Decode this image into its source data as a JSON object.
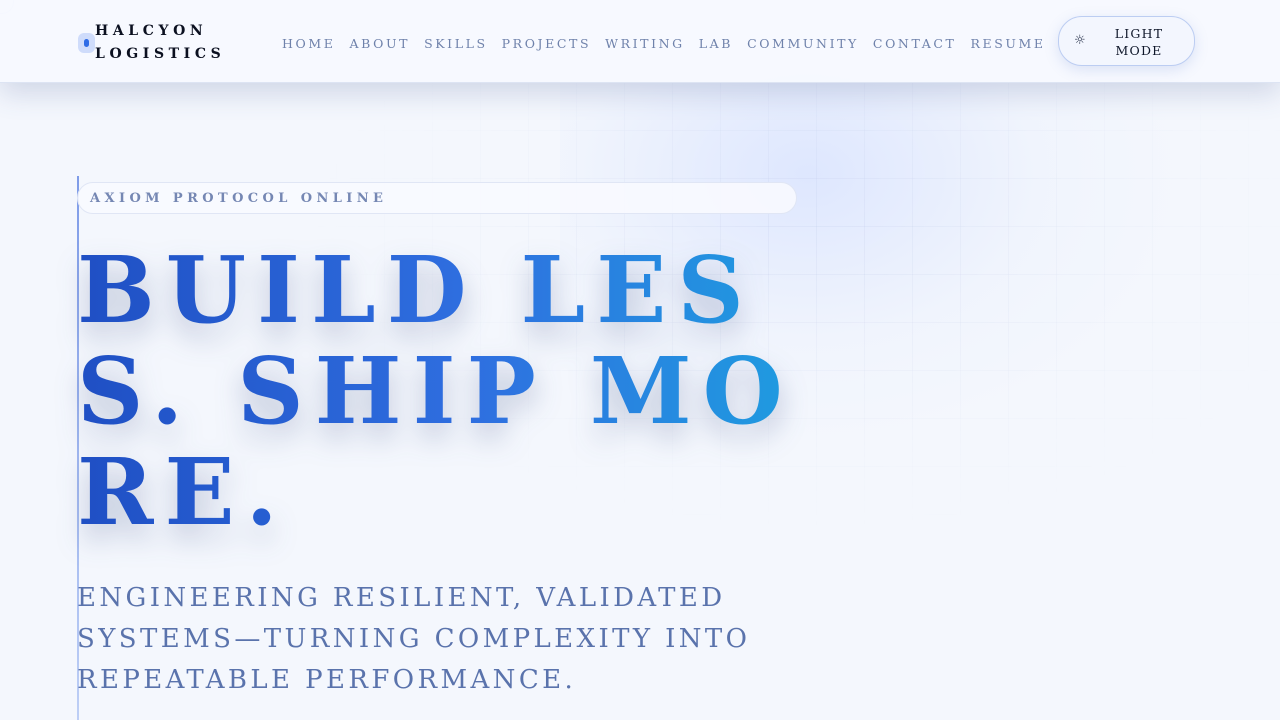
{
  "brand": {
    "name": "HALCYON LOGISTICS"
  },
  "nav": {
    "items": [
      {
        "label": "HOME"
      },
      {
        "label": "ABOUT"
      },
      {
        "label": "SKILLS"
      },
      {
        "label": "PROJECTS"
      },
      {
        "label": "WRITING"
      },
      {
        "label": "LAB"
      },
      {
        "label": "COMMUNITY"
      },
      {
        "label": "CONTACT"
      },
      {
        "label": "RESUME"
      }
    ]
  },
  "mode_toggle": {
    "icon": "sun-icon",
    "label": "LIGHT MODE"
  },
  "hero": {
    "eyebrow": "AXIOM PROTOCOL ONLINE",
    "headline": "BUILD LESS. SHIP MORE.",
    "subhead": "ENGINEERING RESILIENT, VALIDATED SYSTEMS—TURNING COMPLEXITY INTO REPEATABLE PERFORMANCE."
  },
  "colors": {
    "accent": "#2e6be6",
    "headline_gradient_start": "#1f4fc4",
    "headline_gradient_end": "#1f9ce0",
    "muted_text": "#6f82ab",
    "background": "#f4f7fd"
  }
}
